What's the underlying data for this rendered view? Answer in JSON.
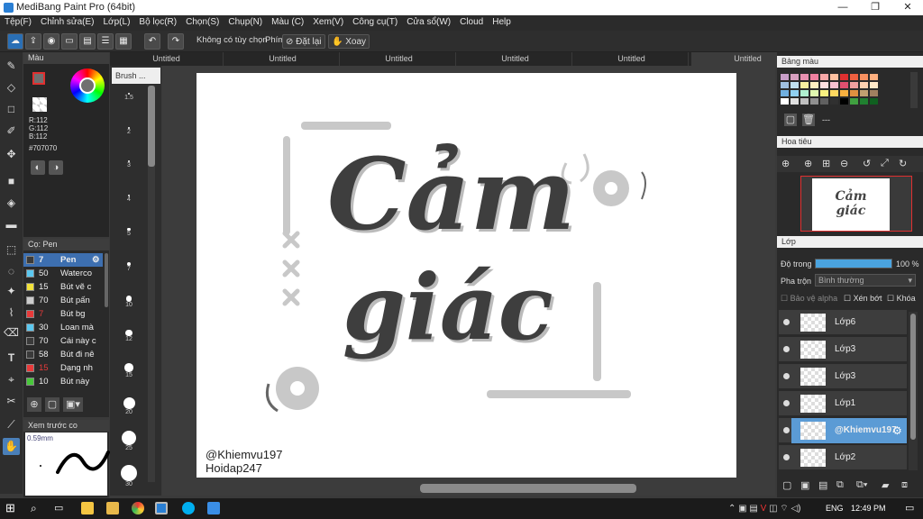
{
  "window": {
    "title": "MediBang Paint Pro (64bit)",
    "minimize": "—",
    "maximize": "❐",
    "close": "✕"
  },
  "menu": [
    "Tệp(F)",
    "Chỉnh sửa(E)",
    "Lớp(L)",
    "Bộ lọc(R)",
    "Chọn(S)",
    "Chụp(N)",
    "Màu (C)",
    "Xem(V)",
    "Công cụ(T)",
    "Cửa sổ(W)",
    "Cloud",
    "Help"
  ],
  "toolbar": {
    "no_option": "Không có tùy chọn",
    "shortcut": "Phím",
    "reset": "Đặt lại",
    "rotate": "Xoay"
  },
  "tabs": [
    "Untitled",
    "Untitled",
    "Untitled",
    "Untitled",
    "Untitled",
    "Untitled"
  ],
  "color_panel": {
    "title": "Màu",
    "r": "R:112",
    "g": "G:112",
    "b": "B:112",
    "hex": "#707070"
  },
  "brush_panel": {
    "title": "Cọ: Pen",
    "brushes": [
      {
        "size": "7",
        "name": "Pen",
        "color": "#3a3a3a",
        "active": true
      },
      {
        "size": "50",
        "name": "Waterco",
        "color": "#5bc8f0"
      },
      {
        "size": "15",
        "name": "Bút vẽ c",
        "color": "#f2e23a"
      },
      {
        "size": "70",
        "name": "Bút pấn",
        "color": "#cccccc"
      },
      {
        "size": "7",
        "name": "Bút bg",
        "color": "#e83a3a"
      },
      {
        "size": "30",
        "name": "Loan mà",
        "color": "#5bc8f0"
      },
      {
        "size": "70",
        "name": "Cái này c",
        "color": "#3a3a3a"
      },
      {
        "size": "58",
        "name": "Bút đi nê",
        "color": "#3a3a3a"
      },
      {
        "size": "15",
        "name": "Dạng nh",
        "color": "#e83a3a"
      },
      {
        "size": "10",
        "name": "Bút này",
        "color": "#48c83a"
      }
    ]
  },
  "brush_size_panel": {
    "title": "Brush ...",
    "sizes": [
      "1.5",
      "2",
      "3",
      "4",
      "5",
      "7",
      "10",
      "12",
      "15",
      "20",
      "25",
      "30"
    ]
  },
  "preview": {
    "title": "Xem trước co",
    "size": "0.59mm"
  },
  "canvas": {
    "line1": "Cảm",
    "line2": "giác",
    "credit1": "@Khiemvu197",
    "credit2": "Hoidap247"
  },
  "palette": {
    "title": "Bảng màu",
    "footer": "---"
  },
  "navigator": {
    "title": "Hoa tiêu"
  },
  "layers": {
    "title": "Lớp",
    "opacity_label": "Độ trong",
    "opacity_value": "100 %",
    "opacity": 1.0,
    "blend_label": "Pha trộn",
    "blend_value": "Bình thường",
    "protect_alpha": "Bảo vệ alpha",
    "clip": "Xén bớt",
    "lock": "Khóa",
    "items": [
      {
        "name": "Lớp6"
      },
      {
        "name": "Lớp3"
      },
      {
        "name": "Lớp3"
      },
      {
        "name": "Lớp1"
      },
      {
        "name": "@Khiemvu197",
        "active": true
      },
      {
        "name": "Lớp2"
      }
    ]
  },
  "taskbar": {
    "lang": "ENG",
    "time": "12:49 PM"
  },
  "colors": {
    "accent": "#4aa3df",
    "active_layer": "#5b9bd5",
    "selected": "#e03030"
  }
}
